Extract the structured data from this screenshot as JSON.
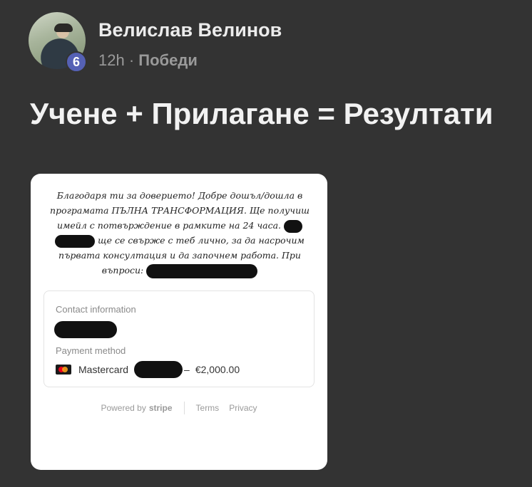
{
  "post": {
    "author_name": "Велислав Велинов",
    "author_level": "6",
    "time_ago": "12h",
    "separator": "·",
    "category": "Победи",
    "title": "Учене + Прилагане = Резултати"
  },
  "receipt": {
    "message_lines": [
      "Благодаря ти за доверието! Добре дошъл/дошла в",
      "програмата ПЪЛНА ТРАНСФОРМАЦИЯ. Ще получиш",
      "имейл с потвърждение в рамките на 24 часа.",
      "ще се свърже с теб лично, за да насрочим",
      "първата консултация и да започнем работа. При",
      "въпроси:"
    ],
    "contact_label": "Contact information",
    "payment_label": "Payment method",
    "card_brand": "Mastercard",
    "dash": "–",
    "amount": "€2,000.00",
    "powered_by": "Powered by",
    "stripe": "stripe",
    "terms": "Terms",
    "privacy": "Privacy"
  }
}
